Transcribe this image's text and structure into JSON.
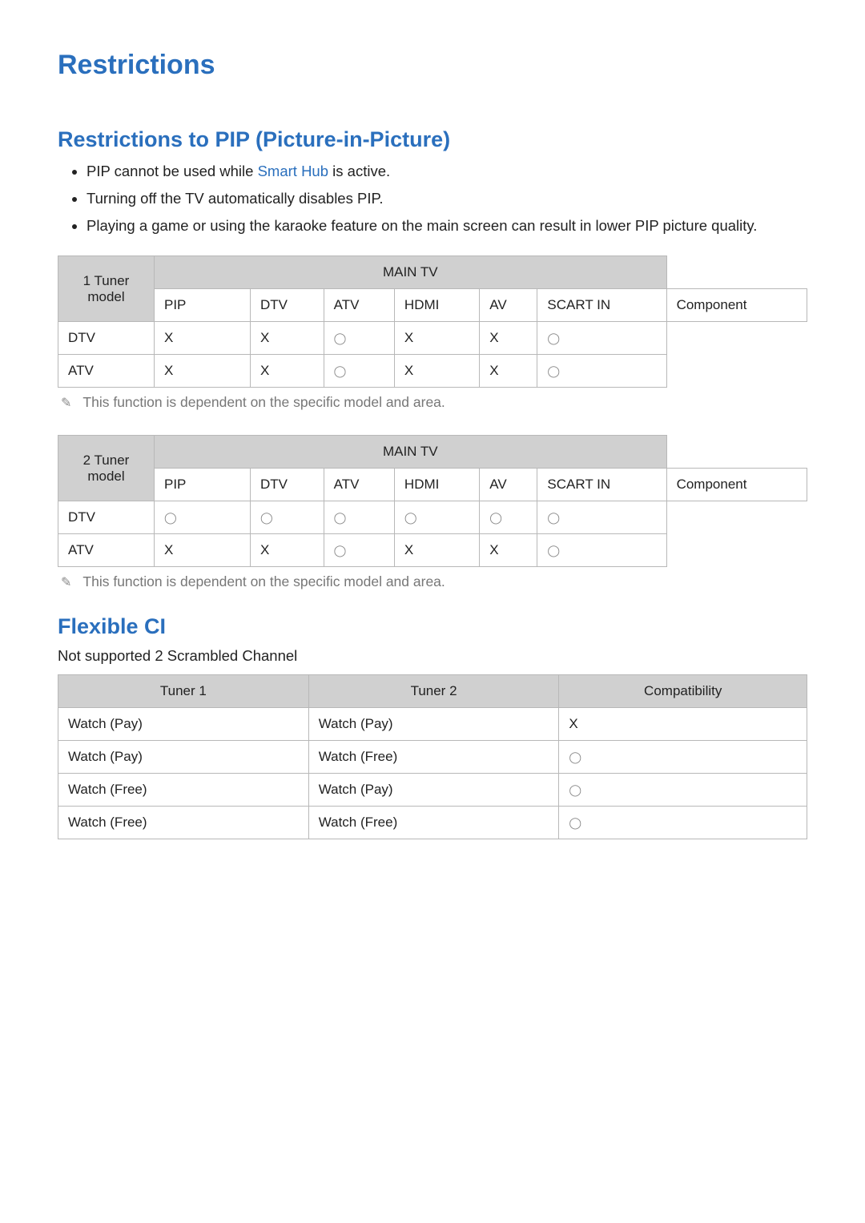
{
  "page_title": "Restrictions",
  "section1": {
    "title": "Restrictions to PIP (Picture-in-Picture)",
    "bullets": [
      {
        "prefix": "PIP cannot be used while ",
        "bold": "Smart Hub",
        "suffix": " is active."
      },
      {
        "text": "Turning off the TV automatically disables PIP."
      },
      {
        "text": "Playing a game or using the karaoke feature on the main screen can result in lower PIP picture quality."
      }
    ]
  },
  "table1": {
    "corner_header": "1 Tuner model",
    "main_header": "MAIN TV",
    "columns": [
      "DTV",
      "ATV",
      "HDMI",
      "AV",
      "SCART IN",
      "Component"
    ],
    "row_title": "PIP",
    "rows": [
      {
        "label": "DTV",
        "cells": [
          "X",
          "X",
          "O",
          "X",
          "X",
          "O"
        ]
      },
      {
        "label": "ATV",
        "cells": [
          "X",
          "X",
          "O",
          "X",
          "X",
          "O"
        ]
      }
    ]
  },
  "note1": "This function is dependent on the specific model and area.",
  "table2": {
    "corner_header": "2 Tuner model",
    "main_header": "MAIN TV",
    "columns": [
      "DTV",
      "ATV",
      "HDMI",
      "AV",
      "SCART IN",
      "Component"
    ],
    "row_title": "PIP",
    "rows": [
      {
        "label": "DTV",
        "cells": [
          "O",
          "O",
          "O",
          "O",
          "O",
          "O"
        ]
      },
      {
        "label": "ATV",
        "cells": [
          "X",
          "X",
          "O",
          "X",
          "X",
          "O"
        ]
      }
    ]
  },
  "note2": "This function is dependent on the specific model and area.",
  "section2": {
    "title": "Flexible CI",
    "subtext": "Not supported 2 Scrambled Channel"
  },
  "table3": {
    "headers": [
      "Tuner 1",
      "Tuner 2",
      "Compatibility"
    ],
    "rows": [
      [
        "Watch (Pay)",
        "Watch (Pay)",
        "X"
      ],
      [
        "Watch (Pay)",
        "Watch (Free)",
        "O"
      ],
      [
        "Watch (Free)",
        "Watch (Pay)",
        "O"
      ],
      [
        "Watch (Free)",
        "Watch (Free)",
        "O"
      ]
    ]
  }
}
